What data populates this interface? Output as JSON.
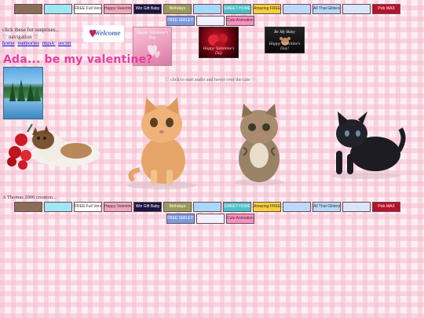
{
  "top_banners": [
    {
      "label": "",
      "bg": "#8a6d55"
    },
    {
      "label": "",
      "bg": "#9ee8f4"
    },
    {
      "label": "FREE Full Version!!!",
      "bg": "#ffffff"
    },
    {
      "label": "Happy Valentine's Day!",
      "bg": "#f2a8bb"
    },
    {
      "label": "Win Gift Baby",
      "bg": "#1a1440"
    },
    {
      "label": "Birthdays",
      "bg": "#9a9a5a"
    },
    {
      "label": "",
      "bg": "#a8d8f8"
    },
    {
      "label": "SWEET HOMEPAGE",
      "bg": "#4cc1c8"
    },
    {
      "label": "Amazing FREE STUFF",
      "bg": "#f5d038"
    },
    {
      "label": "",
      "bg": "#c0d8f8"
    },
    {
      "label": "All That Glitters",
      "bg": "#b8d8f8"
    },
    {
      "label": "",
      "bg": "#d8e6f8"
    },
    {
      "label": "Pick MAX",
      "bg": "#b8112a"
    }
  ],
  "top_banners_row2": [
    {
      "label": "FREE SMILEYS",
      "bg": "#7a9ae0"
    },
    {
      "label": "",
      "bg": "#f0f0ff"
    },
    {
      "label": "Cute Animations",
      "bg": "#f890c0"
    }
  ],
  "intro": {
    "line1": "click these for suuprises...",
    "line2": "♡ navigation ♡",
    "links": [
      "home",
      "memories",
      "music",
      "secret"
    ]
  },
  "welcome_text": "Welcome",
  "vday_card_text": "Happy Valentine's Day",
  "roses_card_text": "Happy Valentine's Day",
  "baby_card": {
    "line1": "Be My Baby",
    "line2": "Happy Valentine's Day!"
  },
  "title": "Ada... be my valentine?",
  "hint": "♡ click to start audio and hover over the cats ♡",
  "footer": "A Thomas 2000 creation...",
  "bottom_banners": [
    {
      "label": "",
      "bg": "#8a6d55"
    },
    {
      "label": "",
      "bg": "#9ee8f4"
    },
    {
      "label": "FREE Full Version!!!",
      "bg": "#ffffff"
    },
    {
      "label": "Happy Valentine's Day!",
      "bg": "#f2a8bb"
    },
    {
      "label": "Win Gift Baby",
      "bg": "#1a1440"
    },
    {
      "label": "Birthdays",
      "bg": "#9a9a5a"
    },
    {
      "label": "",
      "bg": "#a8d8f8"
    },
    {
      "label": "SWEET HOMEPAGE",
      "bg": "#4cc1c8"
    },
    {
      "label": "Amazing FREE STUFF",
      "bg": "#f5d038"
    },
    {
      "label": "",
      "bg": "#c0d8f8"
    },
    {
      "label": "All That Glitters",
      "bg": "#b8d8f8"
    },
    {
      "label": "",
      "bg": "#d8e6f8"
    },
    {
      "label": "Pick MAX",
      "bg": "#b8112a"
    }
  ],
  "bottom_banners_row2": [
    {
      "label": "FREE SMILEYS",
      "bg": "#7a9ae0"
    },
    {
      "label": "",
      "bg": "#f0f0ff"
    },
    {
      "label": "Cute Animations",
      "bg": "#f890c0"
    }
  ],
  "colors": {
    "title": "#e83d9f",
    "link": "#0000cc",
    "background": "#fdeef3"
  }
}
